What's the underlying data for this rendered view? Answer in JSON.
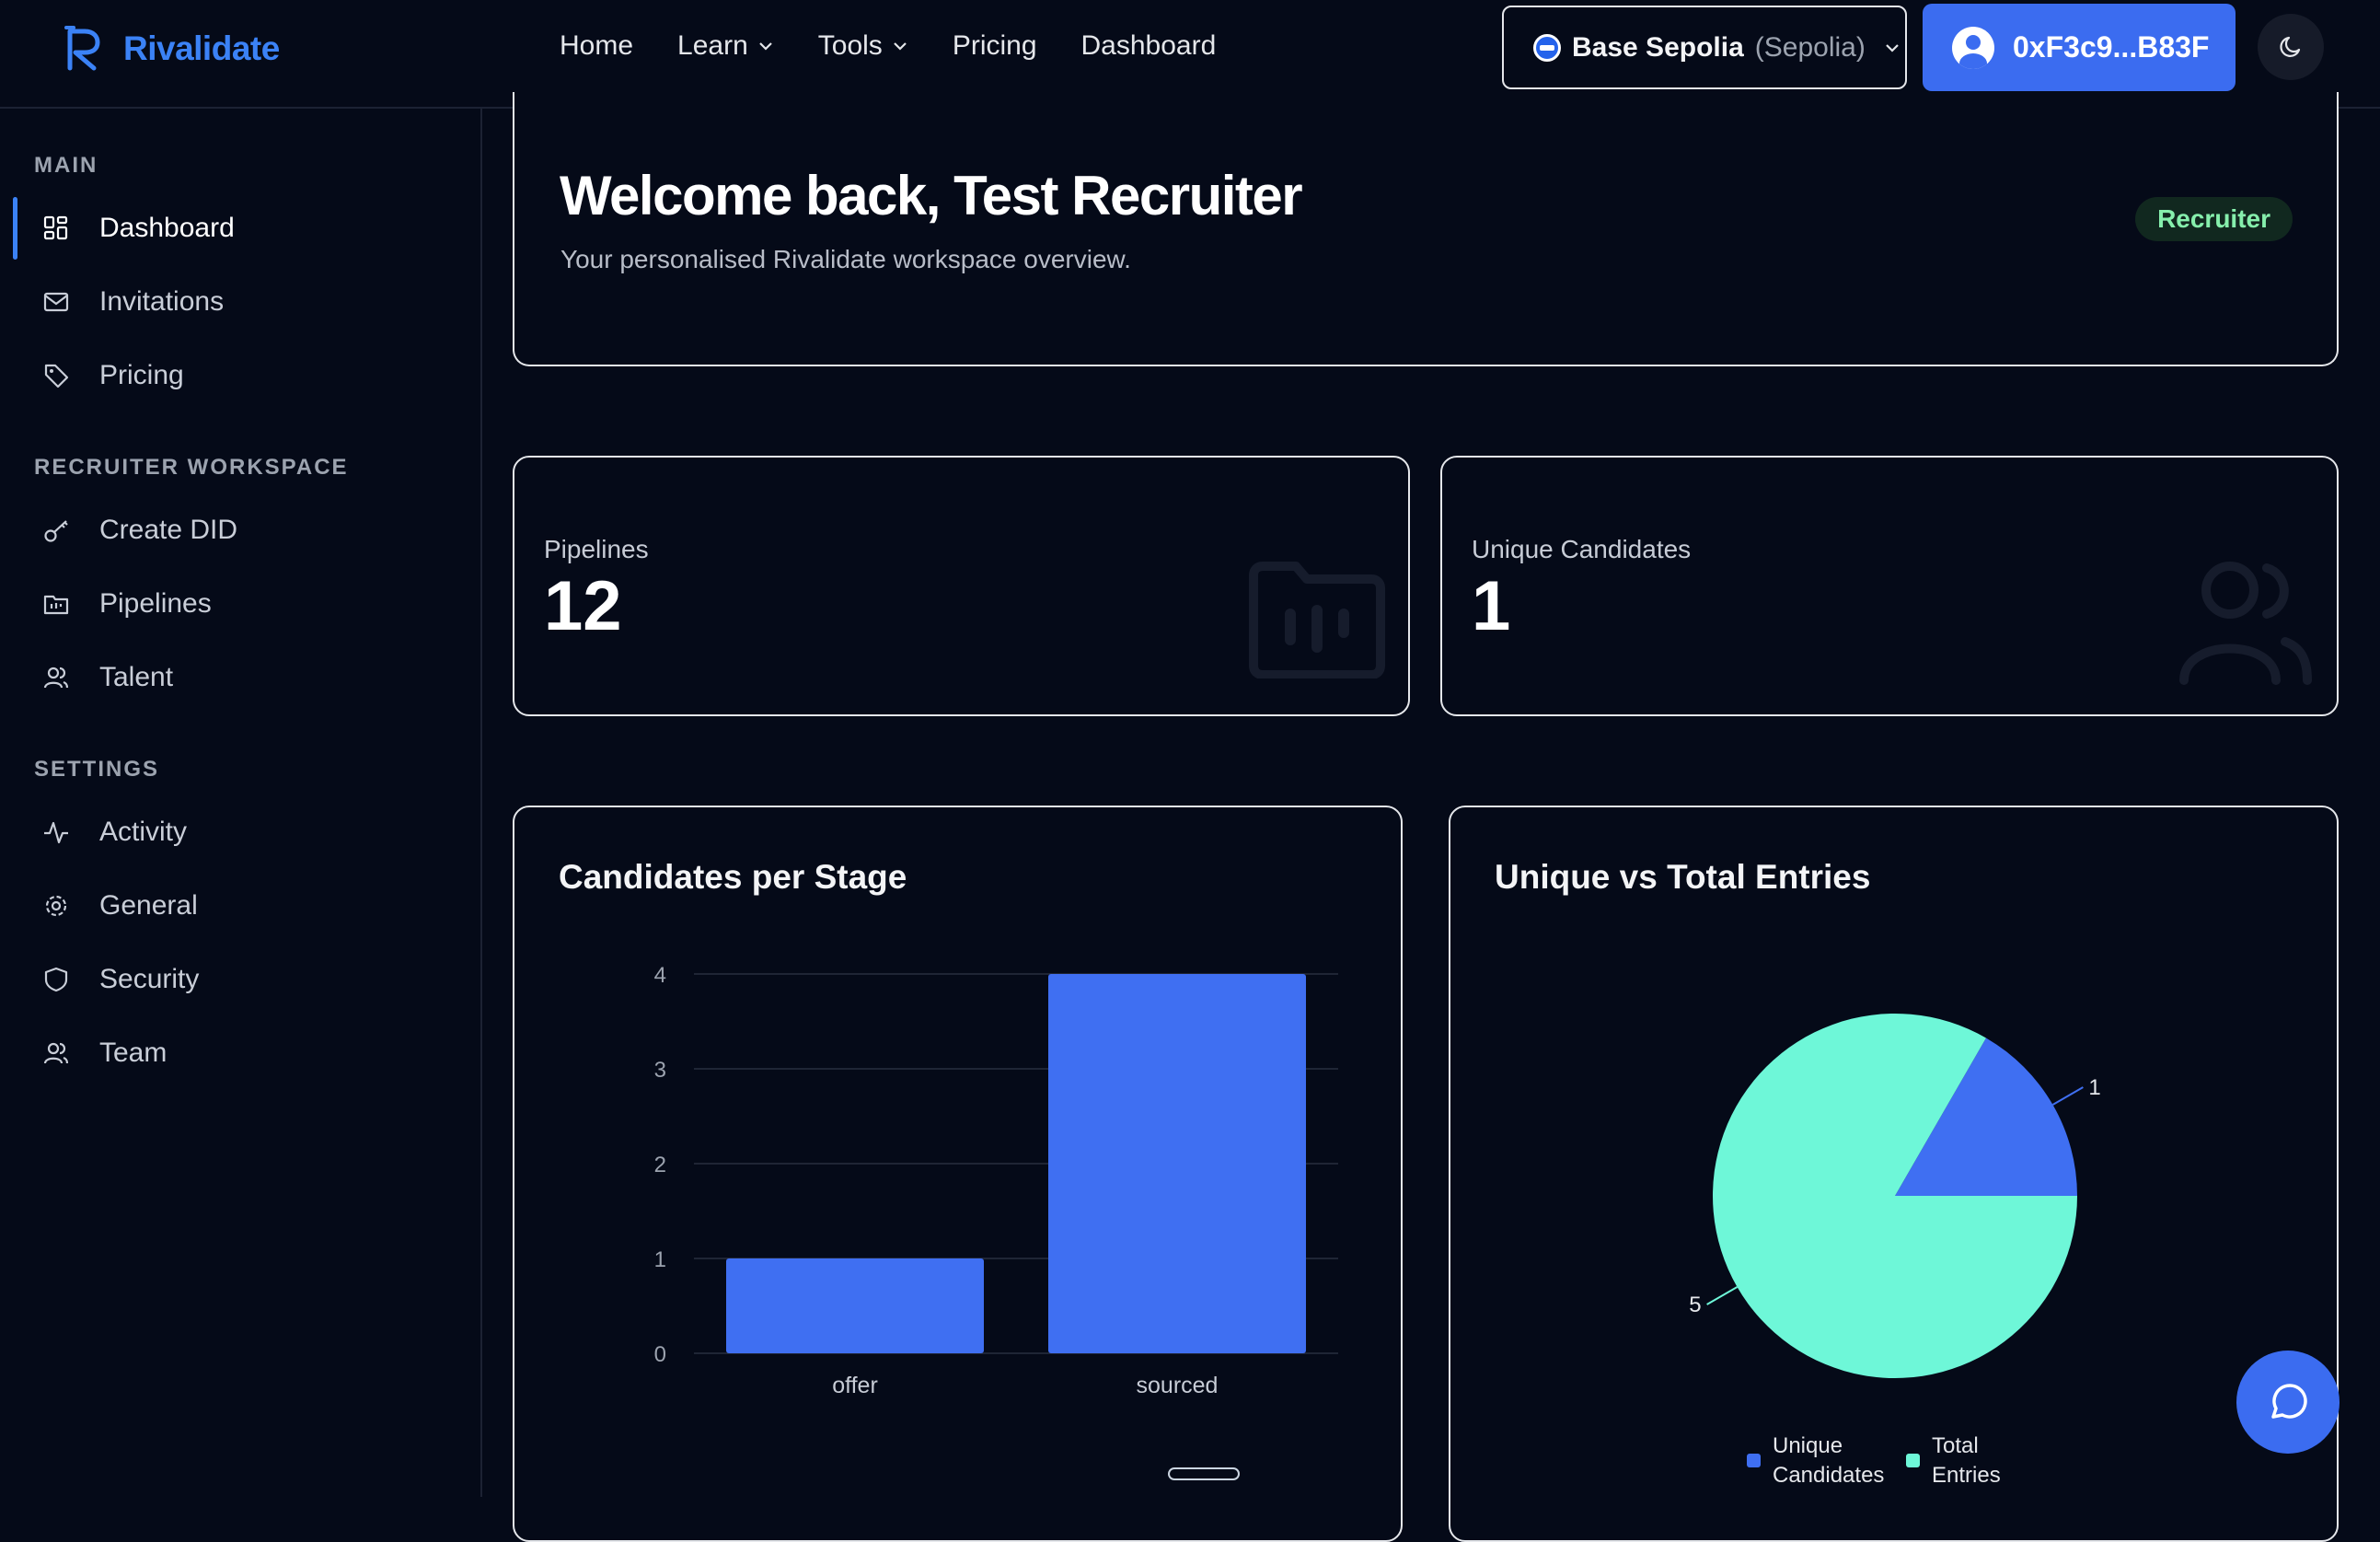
{
  "brand": {
    "name": "Rivalidate",
    "color": "#3b82f6"
  },
  "nav": {
    "items": [
      {
        "label": "Home",
        "dropdown": false
      },
      {
        "label": "Learn",
        "dropdown": true
      },
      {
        "label": "Tools",
        "dropdown": true
      },
      {
        "label": "Pricing",
        "dropdown": false
      },
      {
        "label": "Dashboard",
        "dropdown": false
      }
    ],
    "network": {
      "name": "Base Sepolia",
      "sub": "(Sepolia)"
    },
    "wallet": {
      "address": "0xF3c9...B83F"
    },
    "theme_icon": "moon-icon"
  },
  "sidebar": {
    "sections": [
      {
        "title": "MAIN",
        "items": [
          {
            "label": "Dashboard",
            "icon": "grid-icon",
            "active": true
          },
          {
            "label": "Invitations",
            "icon": "mail-icon",
            "active": false
          },
          {
            "label": "Pricing",
            "icon": "tag-icon",
            "active": false
          }
        ]
      },
      {
        "title": "RECRUITER WORKSPACE",
        "items": [
          {
            "label": "Create DID",
            "icon": "key-icon",
            "active": false
          },
          {
            "label": "Pipelines",
            "icon": "folder-chart-icon",
            "active": false
          },
          {
            "label": "Talent",
            "icon": "users-icon",
            "active": false
          }
        ]
      },
      {
        "title": "SETTINGS",
        "items": [
          {
            "label": "Activity",
            "icon": "activity-icon",
            "active": false
          },
          {
            "label": "General",
            "icon": "gear-icon",
            "active": false
          },
          {
            "label": "Security",
            "icon": "shield-icon",
            "active": false
          },
          {
            "label": "Team",
            "icon": "users-icon",
            "active": false
          }
        ]
      }
    ]
  },
  "welcome": {
    "title": "Welcome back, Test Recruiter",
    "subtitle": "Your personalised Rivalidate workspace overview.",
    "role": "Recruiter"
  },
  "stats": [
    {
      "label": "Pipelines",
      "value": "12",
      "icon": "folder-chart-icon"
    },
    {
      "label": "Unique Candidates",
      "value": "1",
      "icon": "users-icon"
    }
  ],
  "chart_data": [
    {
      "type": "bar",
      "title": "Candidates per Stage",
      "categories": [
        "offer",
        "sourced"
      ],
      "values": [
        1,
        4
      ],
      "ylim": [
        0,
        4
      ],
      "yticks": [
        0,
        1,
        2,
        3,
        4
      ],
      "grid": true,
      "color": "#3f6ff2"
    },
    {
      "type": "pie",
      "title": "Unique vs Total Entries",
      "slices": [
        {
          "name": "Unique Candidates",
          "value": 1,
          "color": "#3f6ff2"
        },
        {
          "name": "Total Entries",
          "value": 5,
          "color": "#6ef7d8"
        }
      ],
      "legend": "bottom"
    }
  ],
  "chat": {
    "icon": "chat-bubble-icon"
  }
}
